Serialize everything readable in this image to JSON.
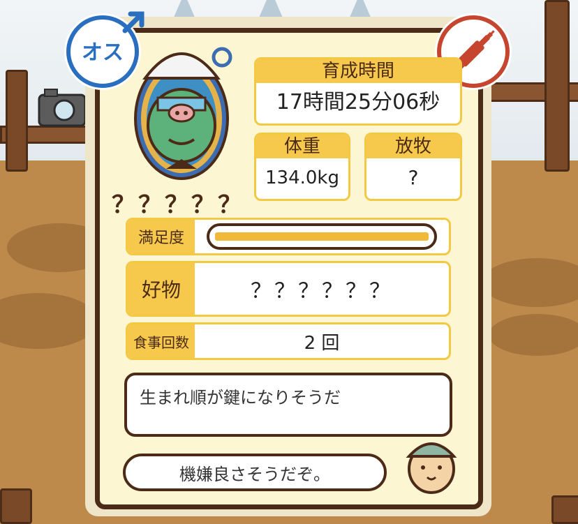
{
  "gender_badge": {
    "label": "オス",
    "icon": "male-symbol-icon",
    "color": "#2a6fbf"
  },
  "injection_badge": {
    "icon": "no-injection-icon",
    "color": "#c5452f"
  },
  "pig": {
    "name": "？？？？？",
    "image": "pig-character-icon"
  },
  "stats": {
    "growth_time_label": "育成時間",
    "growth_time_value": "17時間25分06秒",
    "weight_label": "体重",
    "weight_value": "134.0kg",
    "grazing_label": "放牧",
    "grazing_value": "?"
  },
  "satisfaction": {
    "label": "満足度",
    "level": 1.0
  },
  "favorite": {
    "label": "好物",
    "value": "？？？？？？"
  },
  "meals": {
    "label": "食事回数",
    "value": "2 回"
  },
  "messages": {
    "hint": "生まれ順が鍵になりそうだ",
    "mood": "機嫌良さそうだぞ。"
  },
  "colors": {
    "accent": "#f6c94c",
    "border": "#4b2b17",
    "panel": "#fdf6d3"
  }
}
